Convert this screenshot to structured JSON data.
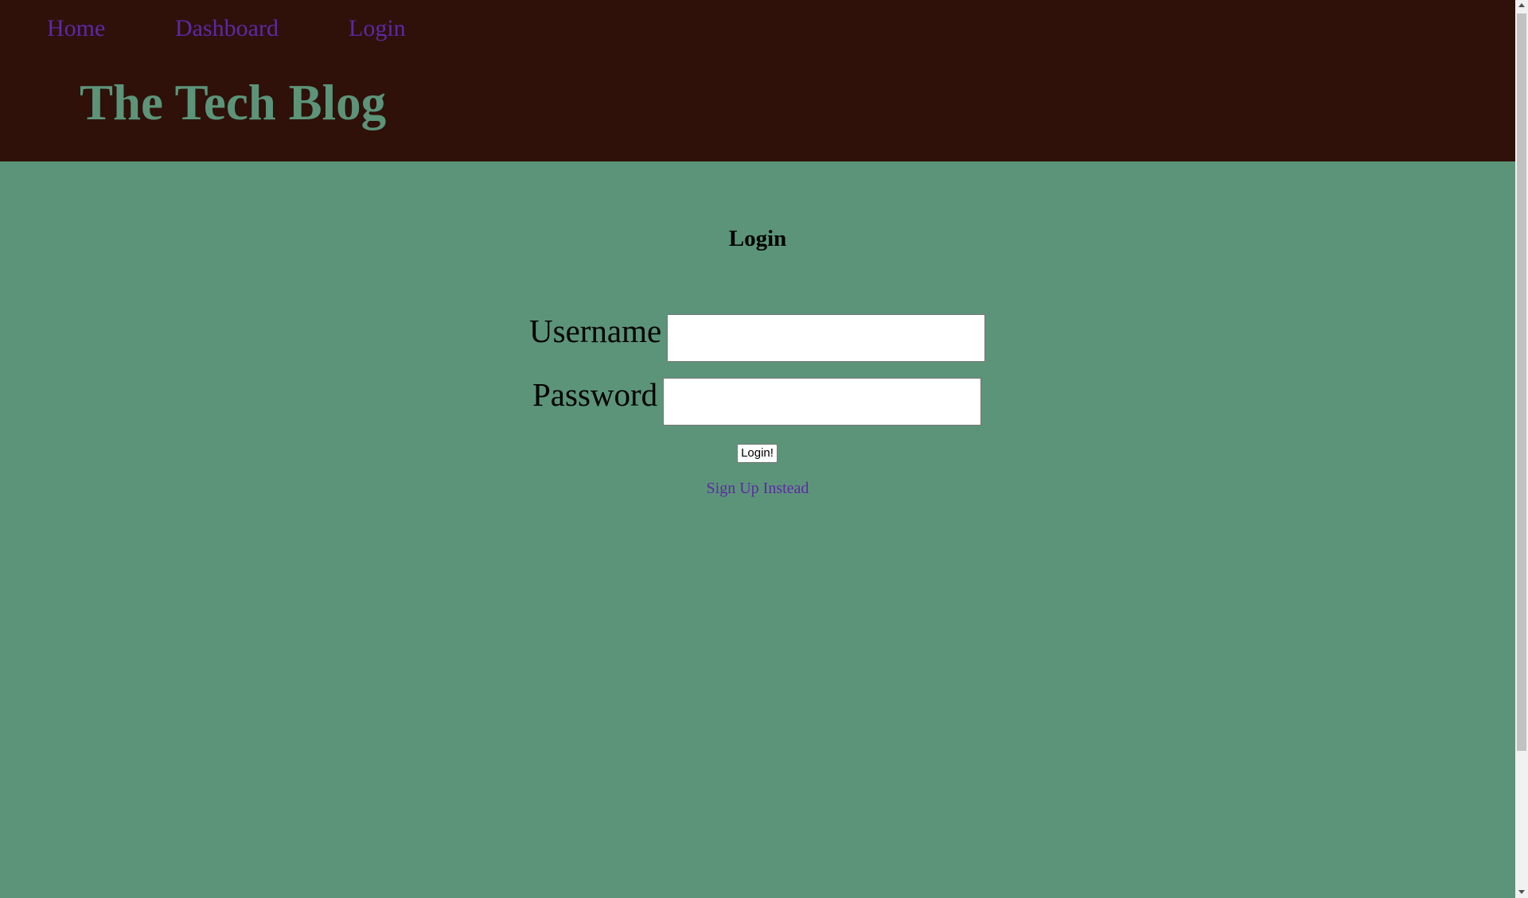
{
  "nav": {
    "items": [
      {
        "label": "Home"
      },
      {
        "label": "Dashboard"
      },
      {
        "label": "Login"
      }
    ]
  },
  "header": {
    "title": "The Tech Blog"
  },
  "login_form": {
    "heading": "Login",
    "username_label": "Username",
    "username_value": "",
    "password_label": "Password",
    "password_value": "",
    "submit_label": "Login!",
    "signup_link": "Sign Up Instead"
  },
  "colors": {
    "header_background": "#2f1109",
    "page_background": "#5c9479",
    "link": "#5c29a8",
    "title": "#5c9479"
  }
}
